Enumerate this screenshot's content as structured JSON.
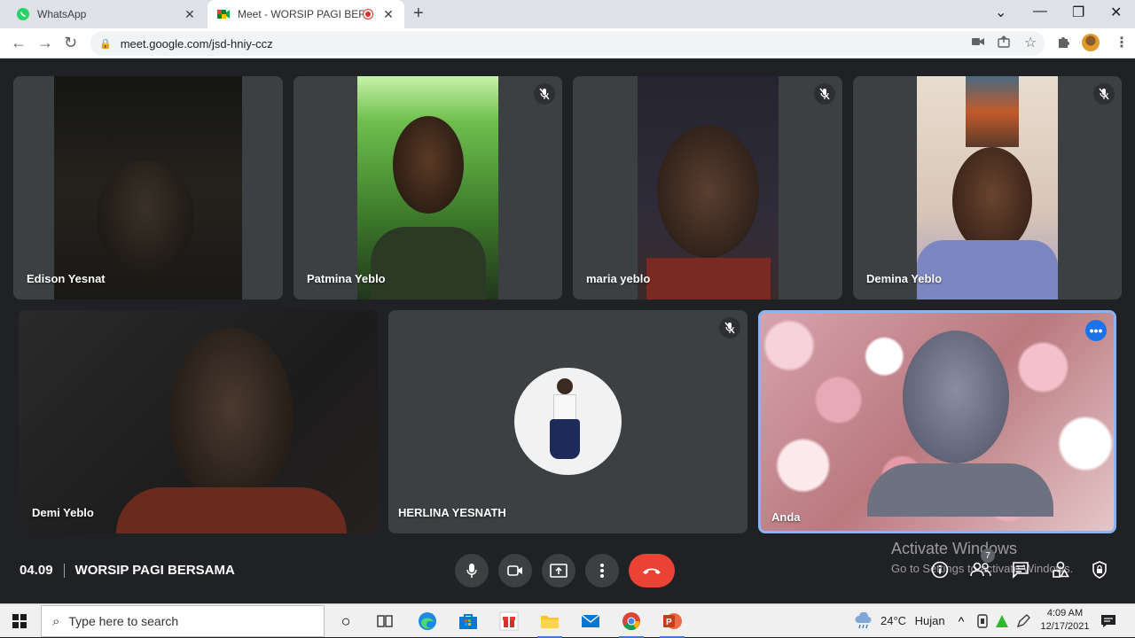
{
  "browser": {
    "tabs": [
      {
        "title": "WhatsApp",
        "active": false
      },
      {
        "title": "Meet - WORSIP PAGI BERSAMA",
        "active": true
      }
    ],
    "url": "meet.google.com/jsd-hniy-ccz"
  },
  "meet": {
    "participants": [
      {
        "name": "Edison Yesnat",
        "muted": false
      },
      {
        "name": "Patmina Yeblo",
        "muted": true
      },
      {
        "name": "maria yeblo",
        "muted": true
      },
      {
        "name": "Demina Yeblo",
        "muted": true
      },
      {
        "name": "Demi Yeblo",
        "muted": false
      },
      {
        "name": "HERLINA YESNATH",
        "muted": true
      },
      {
        "name": "Anda",
        "muted": false
      }
    ],
    "time": "04.09",
    "meeting_name": "WORSIP PAGI BERSAMA",
    "people_count": "7",
    "colors": {
      "end_call": "#ea4335",
      "self_border": "#8ab4f8",
      "tile_bg": "#3c4043"
    }
  },
  "watermark": {
    "line1": "Activate Windows",
    "line2": "Go to Settings to activate Windows."
  },
  "taskbar": {
    "search_placeholder": "Type here to search",
    "weather_temp": "24°C",
    "weather_desc": "Hujan",
    "clock_time": "4:09 AM",
    "clock_date": "12/17/2021"
  }
}
